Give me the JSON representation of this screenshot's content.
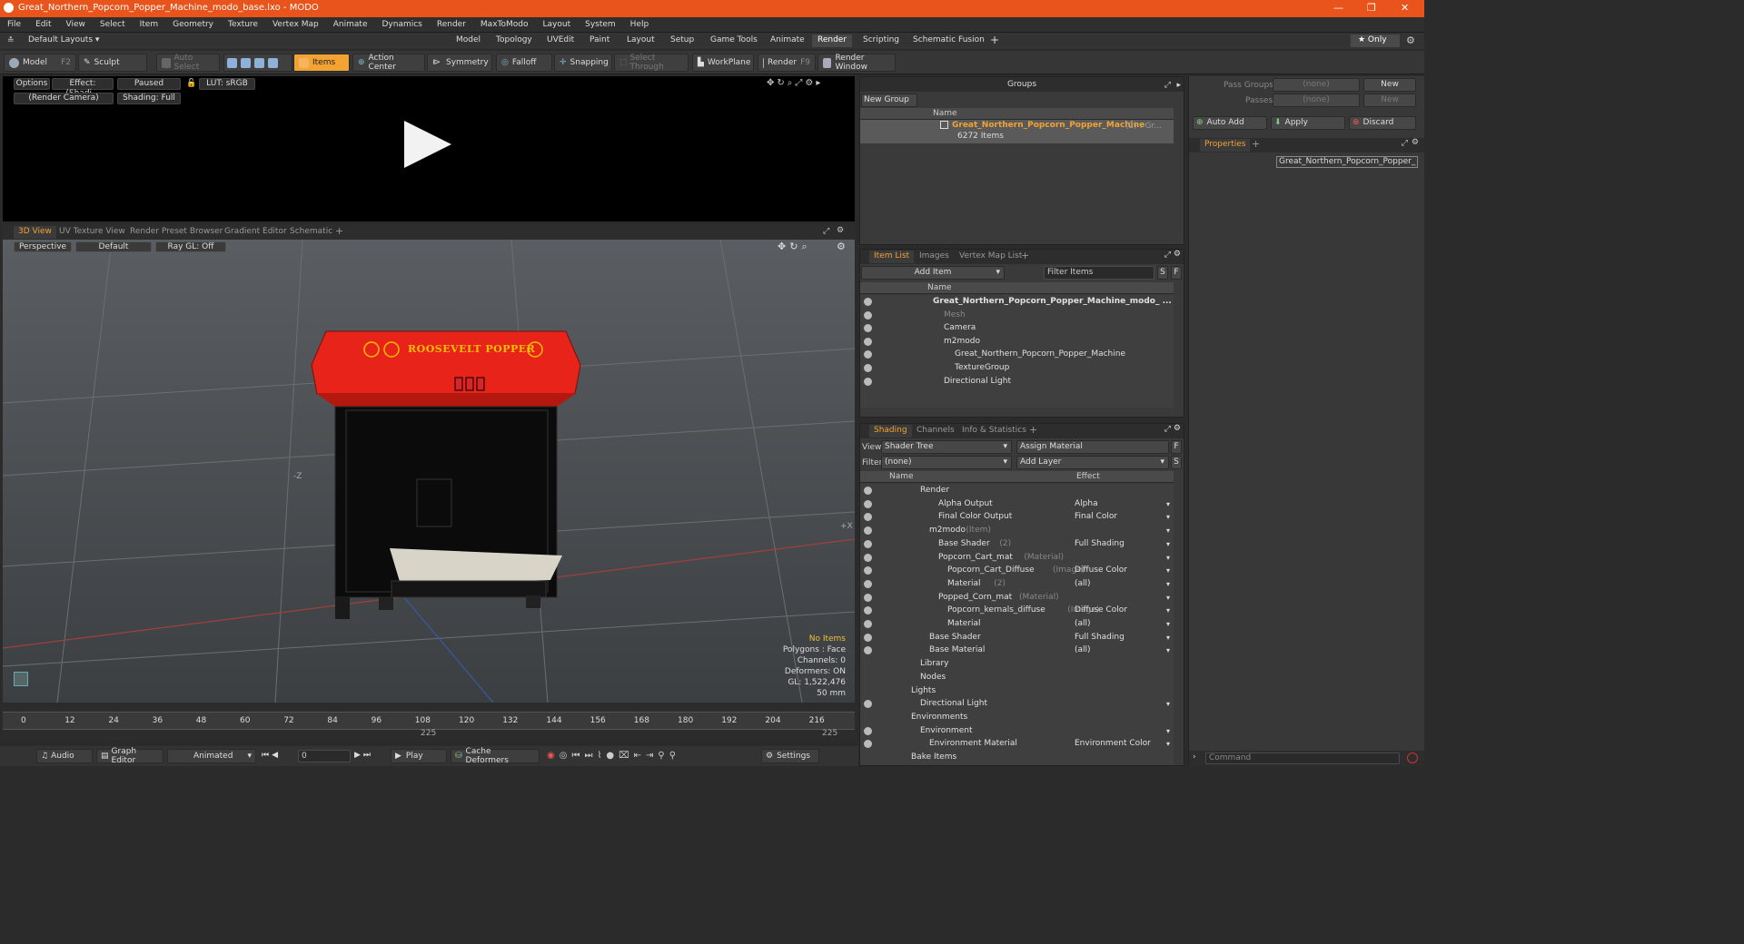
{
  "window": {
    "title": "Great_Northern_Popcorn_Popper_Machine_modo_base.lxo - MODO",
    "minimize": "—",
    "maximize": "❐",
    "close": "✕"
  },
  "menu": [
    "File",
    "Edit",
    "View",
    "Select",
    "Item",
    "Geometry",
    "Texture",
    "Vertex Map",
    "Animate",
    "Dynamics",
    "Render",
    "MaxToModo",
    "Layout",
    "System",
    "Help"
  ],
  "layout": {
    "preset": "Default Layouts ▾",
    "tabs": [
      "Model",
      "Topology",
      "UVEdit",
      "Paint",
      "Layout",
      "Setup",
      "Game Tools",
      "Animate",
      "Render",
      "Scripting",
      "Schematic Fusion",
      "+"
    ],
    "active_tab": "Render",
    "only_label": "★  Only"
  },
  "toolbar": {
    "model": "Model",
    "model_key": "F2",
    "sculpt": "Sculpt",
    "auto_select": "Auto Select",
    "items": "Items",
    "action_center": "Action Center",
    "symmetry": "Symmetry",
    "falloff": "Falloff",
    "snapping": "Snapping",
    "select_through": "Select Through",
    "workplane": "WorkPlane",
    "render": "Render",
    "render_key": "F9",
    "render_window": "Render Window"
  },
  "render_view": {
    "options": "Options",
    "effect": "Effect: (Shadi...",
    "paused": "Paused",
    "lut": "LUT: sRGB",
    "camera": "(Render Camera)",
    "shading": "Shading: Full"
  },
  "view_tabs": [
    "3D View",
    "UV Texture View",
    "Render Preset Browser",
    "Gradient Editor",
    "Schematic",
    "+"
  ],
  "viewport": {
    "perspective": "Perspective",
    "default": "Default",
    "raygl": "Ray GL: Off",
    "model_sign": "ROOSEVELT POPPER",
    "axis_z": "-Z",
    "axis_x": "+X",
    "stats": [
      "No Items",
      "Polygons : Face",
      "Channels: 0",
      "Deformers: ON",
      "GL: 1,522,476",
      "50 mm"
    ]
  },
  "timeline": {
    "ticks": [
      "0",
      "12",
      "24",
      "36",
      "48",
      "60",
      "72",
      "84",
      "96",
      "108",
      "120",
      "132",
      "144",
      "156",
      "168",
      "180",
      "192",
      "204",
      "216"
    ],
    "end_a": "225",
    "end_b": "225"
  },
  "bottom": {
    "audio": "Audio",
    "graph_editor": "Graph Editor",
    "animated": "Animated",
    "frame": "0",
    "play": "Play",
    "cache_deformers": "Cache Deformers",
    "settings": "Settings"
  },
  "groups": {
    "header": "Groups",
    "new_group": "New Group",
    "name_col": "Name",
    "group_name": "Great_Northern_Popcorn_Popper_Machine",
    "group_suffix": "(2) : Gr...",
    "group_count": "6272 Items"
  },
  "item_list": {
    "tabs": [
      "Item List",
      "Images",
      "Vertex Map List",
      "+"
    ],
    "add_item": "Add Item",
    "filter": "Filter Items",
    "name_col": "Name",
    "rows": [
      {
        "label": "Great_Northern_Popcorn_Popper_Machine_modo_ ...",
        "indent": 0
      },
      {
        "label": "Mesh",
        "indent": 1
      },
      {
        "label": "Camera",
        "indent": 1
      },
      {
        "label": "m2modo",
        "indent": 1
      },
      {
        "label": "Great_Northern_Popcorn_Popper_Machine",
        "indent": 2
      },
      {
        "label": "TextureGroup",
        "indent": 2
      },
      {
        "label": "Directional Light",
        "indent": 1
      }
    ]
  },
  "shading": {
    "tabs": [
      "Shading",
      "Channels",
      "Info & Statistics",
      "+"
    ],
    "view_label": "View",
    "view_value": "Shader Tree",
    "assign_material": "Assign Material",
    "filter_label": "Filter",
    "filter_value": "(none)",
    "add_layer": "Add Layer",
    "name_col": "Name",
    "effect_col": "Effect",
    "rows": [
      {
        "label": "Render",
        "extra": "",
        "effect": ""
      },
      {
        "label": "Alpha Output",
        "extra": "",
        "effect": "Alpha"
      },
      {
        "label": "Final Color Output",
        "extra": "",
        "effect": "Final Color"
      },
      {
        "label": "m2modo",
        "extra": "(Item)",
        "effect": ""
      },
      {
        "label": "Base Shader",
        "extra": "(2)",
        "effect": "Full Shading"
      },
      {
        "label": "Popcorn_Cart_mat",
        "extra": "(Material)",
        "effect": ""
      },
      {
        "label": "Popcorn_Cart_Diffuse",
        "extra": "(Image)",
        "effect": "Diffuse Color"
      },
      {
        "label": "Material",
        "extra": "(2)",
        "effect": "(all)"
      },
      {
        "label": "Popped_Corn_mat",
        "extra": "(Material)",
        "effect": ""
      },
      {
        "label": "Popcorn_kernals_diffuse",
        "extra": "(Image)",
        "effect": "Diffuse Color"
      },
      {
        "label": "Material",
        "extra": "",
        "effect": "(all)"
      },
      {
        "label": "Base Shader",
        "extra": "",
        "effect": "Full Shading"
      },
      {
        "label": "Base Material",
        "extra": "",
        "effect": "(all)"
      },
      {
        "label": "Library",
        "extra": "",
        "effect": ""
      },
      {
        "label": "Nodes",
        "extra": "",
        "effect": ""
      },
      {
        "label": "Lights",
        "extra": "",
        "effect": ""
      },
      {
        "label": "Directional Light",
        "extra": "",
        "effect": ""
      },
      {
        "label": "Environments",
        "extra": "",
        "effect": ""
      },
      {
        "label": "Environment",
        "extra": "",
        "effect": ""
      },
      {
        "label": "Environment Material",
        "extra": "",
        "effect": "Environment Color"
      },
      {
        "label": "Bake Items",
        "extra": "",
        "effect": ""
      }
    ]
  },
  "right_panel": {
    "pass_groups": "Pass Groups",
    "passes": "Passes",
    "none": "(none)",
    "new": "New",
    "auto_add": "Auto Add",
    "apply": "Apply",
    "discard": "Discard",
    "properties": "Properties",
    "plus": "+",
    "item_name": "Great_Northern_Popcorn_Popper_",
    "command": "Command"
  },
  "colors": {
    "accent": "#f2a334",
    "titlebar": "#e8541b",
    "popper_red": "#e8231a",
    "group_name": "#f2a334"
  }
}
